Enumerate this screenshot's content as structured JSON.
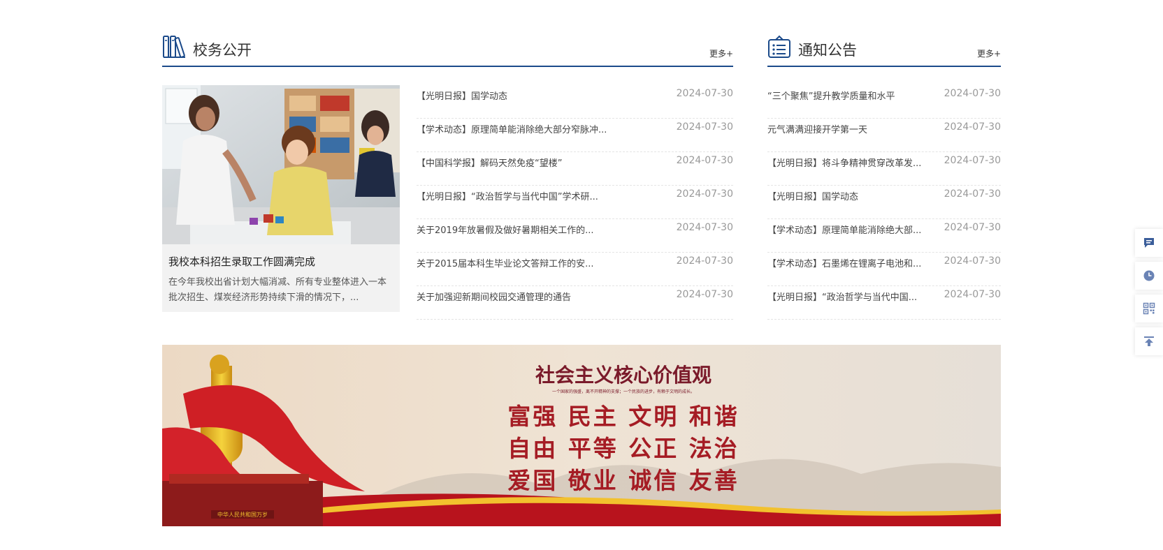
{
  "school_affairs": {
    "title": "校务公开",
    "more": "更多+",
    "feature": {
      "title": "我校本科招生录取工作圆满完成",
      "desc": "在今年我校出省计划大幅消减、所有专业整体进入一本批次招生、煤炭经济形势持续下滑的情况下，..."
    },
    "items": [
      {
        "text": "【光明日报】国学动态",
        "date": "2024-07-30"
      },
      {
        "text": "【学术动态】原理简单能消除绝大部分窄脉冲...",
        "date": "2024-07-30"
      },
      {
        "text": "【中国科学报】解码天然免疫“望楼”",
        "date": "2024-07-30"
      },
      {
        "text": "【光明日报】“政治哲学与当代中国”学术研...",
        "date": "2024-07-30"
      },
      {
        "text": "关于2019年放暑假及做好暑期相关工作的...",
        "date": "2024-07-30"
      },
      {
        "text": "关于2015届本科生毕业论文答辩工作的安...",
        "date": "2024-07-30"
      },
      {
        "text": "关于加强迎新期间校园交通管理的通告",
        "date": "2024-07-30"
      }
    ]
  },
  "notices": {
    "title": "通知公告",
    "more": "更多+",
    "items": [
      {
        "text": "“三个聚焦”提升教学质量和水平",
        "date": "2024-07-30"
      },
      {
        "text": "元气满满迎接开学第一天",
        "date": "2024-07-30"
      },
      {
        "text": "【光明日报】将斗争精神贯穿改革发...",
        "date": "2024-07-30"
      },
      {
        "text": "【光明日报】国学动态",
        "date": "2024-07-30"
      },
      {
        "text": "【学术动态】原理简单能消除绝大部...",
        "date": "2024-07-30"
      },
      {
        "text": "【学术动态】石墨烯在锂离子电池和...",
        "date": "2024-07-30"
      },
      {
        "text": "【光明日报】“政治哲学与当代中国...",
        "date": "2024-07-30"
      }
    ]
  },
  "banner": {
    "heading": "社会主义核心价值观",
    "subheading": "一个国家的强盛，离不开精神的支撑；一个民族的进步，有赖于文明的成长。",
    "rows": [
      "富强 民主 文明 和谐",
      "自由 平等 公正 法治",
      "爱国 敬业 诚信 友善"
    ],
    "plaque": "中华人民共和国万岁"
  },
  "colors": {
    "accent": "#1b4a8a",
    "banner_red": "#a51c24"
  },
  "side_tools": [
    "message-icon",
    "clock-icon",
    "qrcode-icon",
    "back-to-top-icon"
  ]
}
